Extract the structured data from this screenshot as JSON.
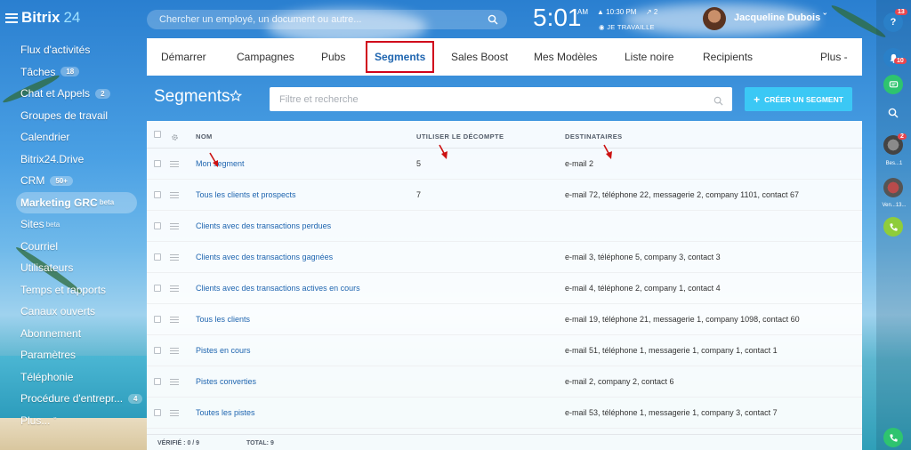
{
  "app": {
    "logo_name": "Bitrix",
    "logo_number": "24"
  },
  "sidebar": {
    "items": [
      {
        "label": "Flux d'activités",
        "badge": ""
      },
      {
        "label": "Tâches",
        "badge": "18"
      },
      {
        "label": "Chat et Appels",
        "badge": "2"
      },
      {
        "label": "Groupes de travail",
        "badge": ""
      },
      {
        "label": "Calendrier",
        "badge": ""
      },
      {
        "label": "Bitrix24.Drive",
        "badge": ""
      },
      {
        "label": "CRM",
        "badge": "50+"
      },
      {
        "label": "Marketing GRC",
        "sup": "beta",
        "active": true
      },
      {
        "label": "Sites",
        "sup": "beta"
      },
      {
        "label": "Courriel",
        "badge": ""
      },
      {
        "label": "Utilisateurs",
        "badge": ""
      },
      {
        "label": "Temps et rapports",
        "badge": ""
      },
      {
        "label": "Canaux ouverts",
        "badge": ""
      },
      {
        "label": "Abonnement",
        "badge": ""
      },
      {
        "label": "Paramètres",
        "badge": ""
      },
      {
        "label": "Téléphonie",
        "badge": ""
      },
      {
        "label": "Procédure d'entrepr...",
        "badge": "4"
      },
      {
        "label": "Plus...",
        "more": "ˇ"
      }
    ]
  },
  "header": {
    "search_placeholder": "Chercher un employé, un document ou autre...",
    "time": "5:01",
    "ampm": "AM",
    "alarm": "▲ 10:30 PM",
    "count": "↗ 2",
    "status": "◉ JE TRAVAILLE",
    "user_name": "Jacqueline Dubois ˇ"
  },
  "rightbar": {
    "help_badge": "13",
    "notif_badge": "10",
    "chat1_badge": "2",
    "chat1_label": "Bes...1",
    "chat2_label": "Ven...13...",
    "help_glyph": "?"
  },
  "tabs": [
    {
      "label": "Démarrer"
    },
    {
      "label": "Campagnes"
    },
    {
      "label": "Pubs"
    },
    {
      "label": "Segments",
      "current": true
    },
    {
      "label": "Sales Boost"
    },
    {
      "label": "Mes Modèles"
    },
    {
      "label": "Liste noire"
    },
    {
      "label": "Recipients"
    },
    {
      "label": "Plus -"
    }
  ],
  "page": {
    "title": "Segments",
    "filter_placeholder": "Filtre et recherche",
    "create_button": "CRÉER UN SEGMENT",
    "create_plus": "+"
  },
  "table": {
    "columns": {
      "name": "NOM",
      "count": "UTILISER LE DÉCOMPTE",
      "recipients": "DESTINATAIRES"
    },
    "rows": [
      {
        "name": "Mon segment",
        "count": "5",
        "recipients": "e-mail 2"
      },
      {
        "name": "Tous les clients et prospects",
        "count": "7",
        "recipients": "e-mail 72, téléphone 22, messagerie 2, company 1101, contact 67"
      },
      {
        "name": "Clients avec des transactions perdues",
        "count": "",
        "recipients": ""
      },
      {
        "name": "Clients avec des transactions gagnées",
        "count": "",
        "recipients": "e-mail 3, téléphone 5, company 3, contact 3"
      },
      {
        "name": "Clients avec des transactions actives en cours",
        "count": "",
        "recipients": "e-mail 4, téléphone 2, company 1, contact 4"
      },
      {
        "name": "Tous les clients",
        "count": "",
        "recipients": "e-mail 19, téléphone 21, messagerie 1, company 1098, contact 60"
      },
      {
        "name": "Pistes en cours",
        "count": "",
        "recipients": "e-mail 51, téléphone 1, messagerie 1, company 1, contact 1"
      },
      {
        "name": "Pistes converties",
        "count": "",
        "recipients": "e-mail 2, company 2, contact 6"
      },
      {
        "name": "Toutes les pistes",
        "count": "",
        "recipients": "e-mail 53, téléphone 1, messagerie 1, company 3, contact 7"
      }
    ],
    "footer": {
      "verified": "VÉRIFIÉ : 0 / 9",
      "total": "TOTAL: 9"
    }
  },
  "colors": {
    "accent": "#3bc8f5",
    "link": "#2066b0",
    "highlight": "#d0021b",
    "annotation": "#cc1111"
  }
}
